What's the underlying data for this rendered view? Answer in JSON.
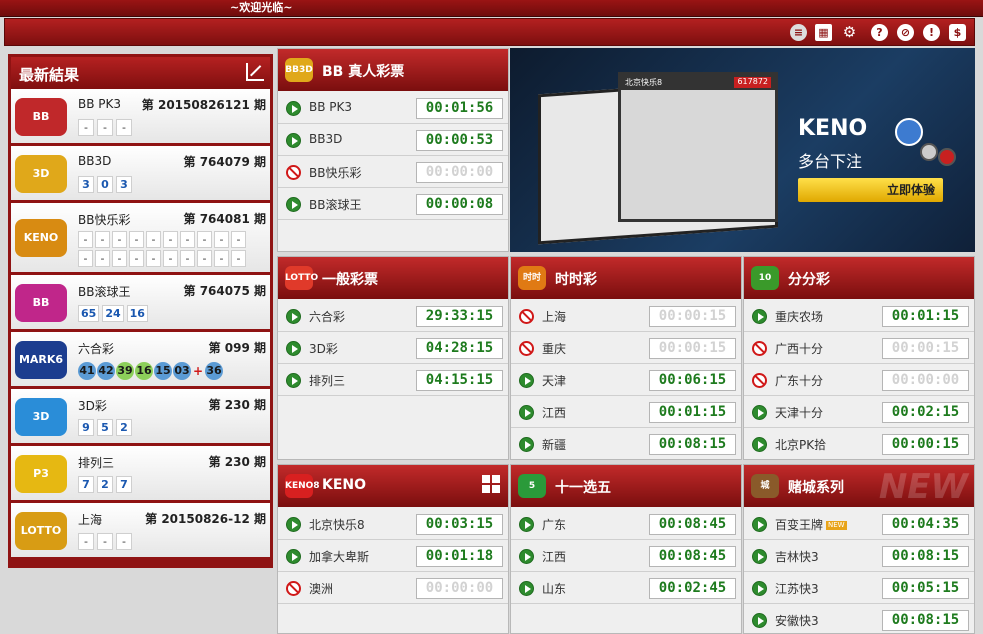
{
  "topbar": {
    "welcome": "~欢迎光临~"
  },
  "toolbar": {
    "icons": [
      "coin-stack-icon",
      "calendar-icon",
      "gears-icon",
      "help-icon",
      "rules-icon",
      "alert-icon",
      "dollar-icon"
    ]
  },
  "latest": {
    "title": "最新結果",
    "items": [
      {
        "name": "BB PK3",
        "issue": "第 20150826121 期",
        "balls": [
          "-",
          "-",
          "-"
        ],
        "logo_color": "#c0282a"
      },
      {
        "name": "BB3D",
        "issue": "第 764079 期",
        "balls": [
          "3",
          "0",
          "3"
        ],
        "logo_color": "#e0a81a"
      },
      {
        "name": "BB快乐彩",
        "issue": "第 764081 期",
        "balls_row1": [
          "-",
          "-",
          "-",
          "-",
          "-",
          "-",
          "-",
          "-",
          "-",
          "-"
        ],
        "balls_row2": [
          "-",
          "-",
          "-",
          "-",
          "-",
          "-",
          "-",
          "-",
          "-",
          "-"
        ],
        "logo_color": "#d88b12"
      },
      {
        "name": "BB滚球王",
        "issue": "第 764075 期",
        "balls": [
          "65",
          "24",
          "16"
        ],
        "logo_color": "#c0268a"
      },
      {
        "name": "六合彩",
        "issue": "第 099 期",
        "balls": [
          "41",
          "42",
          "39",
          "16",
          "15",
          "03"
        ],
        "plus": "+",
        "special": "36",
        "logo_color": "#1c3d8f"
      },
      {
        "name": "3D彩",
        "issue": "第 230 期",
        "balls": [
          "9",
          "5",
          "2"
        ],
        "logo_color": "#2a8dd8"
      },
      {
        "name": "排列三",
        "issue": "第 230 期",
        "balls": [
          "7",
          "2",
          "7"
        ],
        "logo_color": "#e6b812"
      },
      {
        "name": "上海",
        "issue": "第 20150826-12 期",
        "balls": [
          "-",
          "-",
          "-"
        ],
        "logo_color": "#d89c14"
      }
    ]
  },
  "panels": {
    "bb": {
      "title": "BB 真人彩票",
      "icon": "BB3D",
      "rows": [
        {
          "name": "BB PK3",
          "time": "00:01:56",
          "status": "open"
        },
        {
          "name": "BB3D",
          "time": "00:00:53",
          "status": "open"
        },
        {
          "name": "BB快乐彩",
          "time": "00:00:00",
          "status": "closed"
        },
        {
          "name": "BB滚球王",
          "time": "00:00:08",
          "status": "open"
        }
      ]
    },
    "general": {
      "title": "一般彩票",
      "icon": "LOTTO",
      "rows": [
        {
          "name": "六合彩",
          "time": "29:33:15",
          "status": "open"
        },
        {
          "name": "3D彩",
          "time": "04:28:15",
          "status": "open"
        },
        {
          "name": "排列三",
          "time": "04:15:15",
          "status": "open"
        }
      ]
    },
    "shishi": {
      "title": "时时彩",
      "icon": "时时",
      "rows": [
        {
          "name": "上海",
          "time": "00:00:15",
          "status": "closed"
        },
        {
          "name": "重庆",
          "time": "00:00:15",
          "status": "closed"
        },
        {
          "name": "天津",
          "time": "00:06:15",
          "status": "open"
        },
        {
          "name": "江西",
          "time": "00:01:15",
          "status": "open"
        },
        {
          "name": "新疆",
          "time": "00:08:15",
          "status": "open"
        }
      ]
    },
    "fenfen": {
      "title": "分分彩",
      "icon": "10",
      "rows": [
        {
          "name": "重庆农场",
          "time": "00:01:15",
          "status": "open"
        },
        {
          "name": "广西十分",
          "time": "00:00:15",
          "status": "closed"
        },
        {
          "name": "广东十分",
          "time": "00:00:00",
          "status": "closed"
        },
        {
          "name": "天津十分",
          "time": "00:02:15",
          "status": "open"
        },
        {
          "name": "北京PK拾",
          "time": "00:00:15",
          "status": "open"
        }
      ]
    },
    "keno": {
      "title": "KENO",
      "icon": "KENO8",
      "rows": [
        {
          "name": "北京快乐8",
          "time": "00:03:15",
          "status": "open"
        },
        {
          "name": "加拿大卑斯",
          "time": "00:01:18",
          "status": "open"
        },
        {
          "name": "澳洲",
          "time": "00:00:00",
          "status": "closed"
        }
      ]
    },
    "eleven": {
      "title": "十一选五",
      "icon": "5",
      "rows": [
        {
          "name": "广东",
          "time": "00:08:45",
          "status": "open"
        },
        {
          "name": "江西",
          "time": "00:08:45",
          "status": "open"
        },
        {
          "name": "山东",
          "time": "00:02:45",
          "status": "open"
        }
      ]
    },
    "casino": {
      "title": "赌城系列",
      "icon": "城",
      "watermark": "NEW",
      "new_badge": "NEW",
      "rows": [
        {
          "name": "百变王牌",
          "time": "00:04:35",
          "status": "open",
          "new": true
        },
        {
          "name": "吉林快3",
          "time": "00:08:15",
          "status": "open"
        },
        {
          "name": "江苏快3",
          "time": "00:05:15",
          "status": "open"
        },
        {
          "name": "安徽快3",
          "time": "00:08:15",
          "status": "open"
        }
      ]
    }
  },
  "promo": {
    "brand": "KENO",
    "subtitle": "多台下注",
    "button": "立即体验",
    "button_arrow": "»",
    "screen_title": "北京快乐8",
    "screen_number": "617872"
  }
}
